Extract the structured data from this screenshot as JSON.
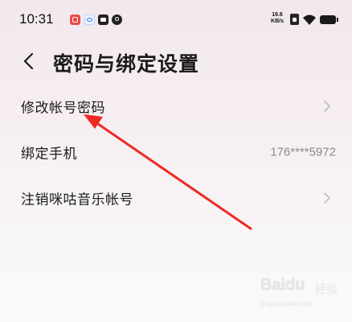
{
  "status_bar": {
    "time": "10:31",
    "net_speed_value": "16.6",
    "net_speed_unit": "KB/s",
    "icons": [
      "app-notification-red-icon",
      "app-notification-blue-icon",
      "message-icon",
      "app-notification-dark-icon",
      "sim-card-icon",
      "wifi-icon",
      "battery-icon"
    ]
  },
  "header": {
    "back_icon": "chevron-left-icon",
    "title": "密码与绑定设置"
  },
  "settings": [
    {
      "label": "修改帐号密码",
      "value": "",
      "chevron": true
    },
    {
      "label": "绑定手机",
      "value": "176****5972",
      "chevron": false
    },
    {
      "label": "注销咪咕音乐帐号",
      "value": "",
      "chevron": true
    }
  ],
  "watermark": {
    "main": "Baidu",
    "sub": "经验",
    "url": "jingyan.baidu.com"
  },
  "colors": {
    "annotation_arrow": "#ee2a24",
    "title_text": "#1b1b1b",
    "secondary_text": "#8a8a8a"
  }
}
